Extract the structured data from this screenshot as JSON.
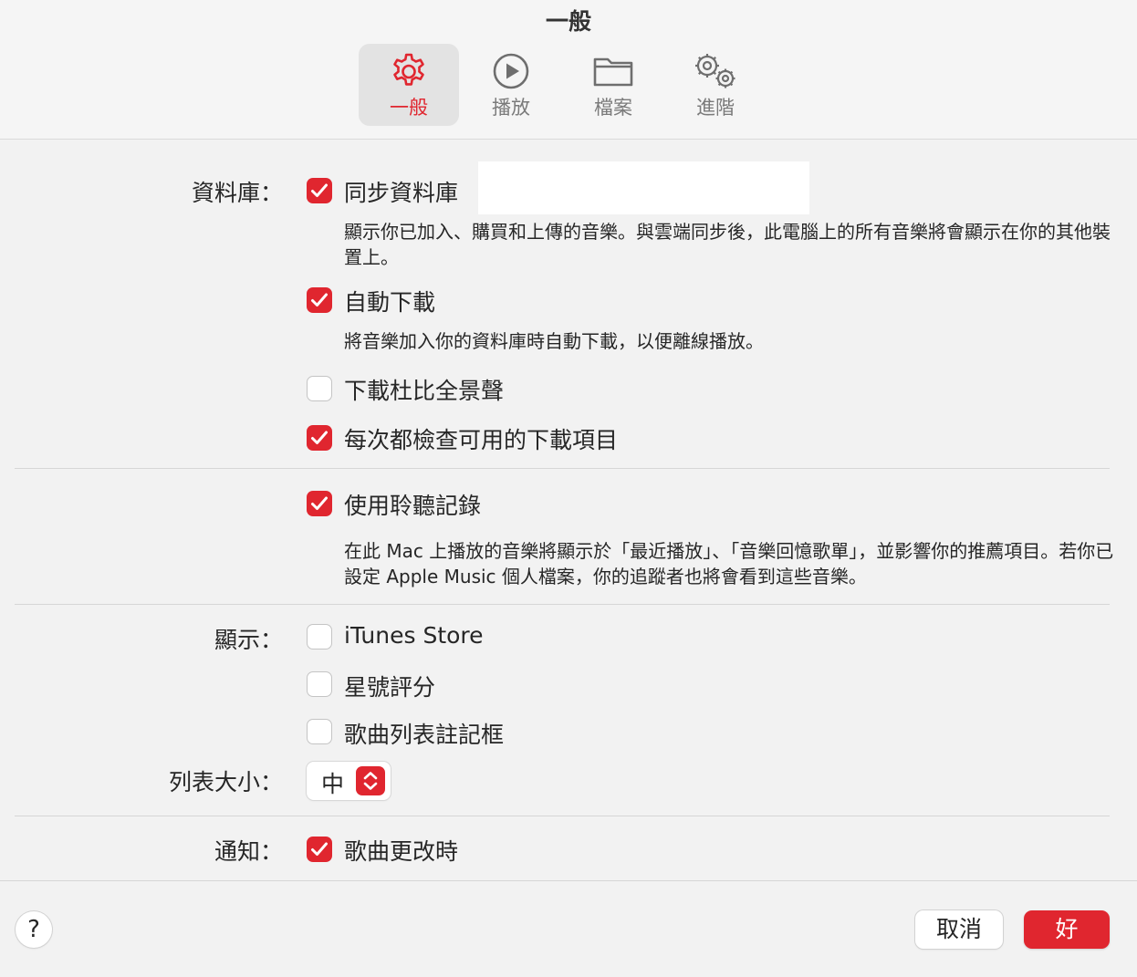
{
  "window": {
    "title": "一般"
  },
  "tabs": [
    {
      "label": "一般",
      "icon": "gear-icon",
      "selected": true
    },
    {
      "label": "播放",
      "icon": "play-circle-icon",
      "selected": false
    },
    {
      "label": "檔案",
      "icon": "folder-icon",
      "selected": false
    },
    {
      "label": "進階",
      "icon": "gears-icon",
      "selected": false
    }
  ],
  "library": {
    "label": "資料庫：",
    "sync": {
      "label": "同步資料庫",
      "checked": true,
      "desc": "顯示你已加入、購買和上傳的音樂。與雲端同步後，此電腦上的所有音樂將會顯示在你的其他裝置上。"
    },
    "auto_download": {
      "label": "自動下載",
      "checked": true,
      "desc": "將音樂加入你的資料庫時自動下載，以便離線播放。"
    },
    "dolby": {
      "label": "下載杜比全景聲",
      "checked": false
    },
    "check_downloads": {
      "label": "每次都檢查可用的下載項目",
      "checked": true
    }
  },
  "listening": {
    "label": "使用聆聽記錄",
    "checked": true,
    "desc": "在此 Mac 上播放的音樂將顯示於「最近播放」、「音樂回憶歌單」，並影響你的推薦項目。若你已設定 Apple Music 個人檔案，你的追蹤者也將會看到這些音樂。"
  },
  "display": {
    "label": "顯示：",
    "itunes_store": {
      "label": "iTunes Store",
      "checked": false
    },
    "star_ratings": {
      "label": "星號評分",
      "checked": false
    },
    "song_list_checkboxes": {
      "label": "歌曲列表註記框",
      "checked": false
    }
  },
  "list_size": {
    "label": "列表大小：",
    "value": "中"
  },
  "notifications": {
    "label": "通知：",
    "song_changes": {
      "label": "歌曲更改時",
      "checked": true
    }
  },
  "footer": {
    "help_label": "?",
    "cancel_label": "取消",
    "ok_label": "好"
  },
  "colors": {
    "accent": "#e0262f",
    "background": "#f2f2f2"
  }
}
